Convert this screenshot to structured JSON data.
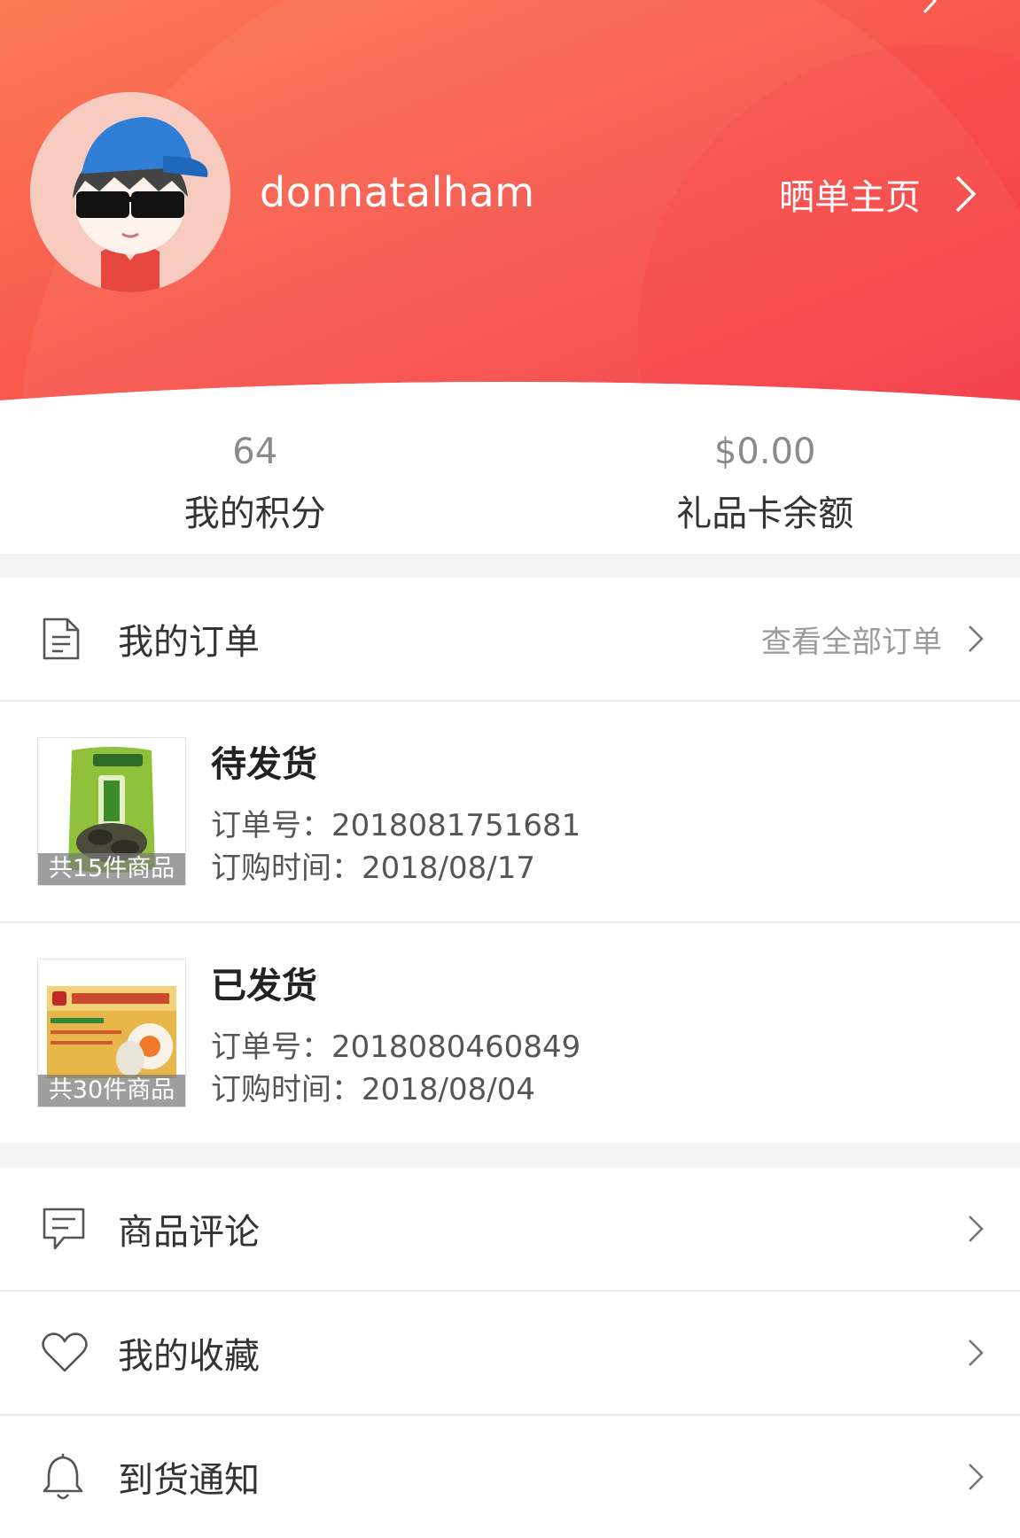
{
  "profile": {
    "username": "donnatalham",
    "homepage_label": "晒单主页"
  },
  "stats": [
    {
      "value": "64",
      "label": "我的积分"
    },
    {
      "value": "$0.00",
      "label": "礼品卡余额"
    }
  ],
  "orders_section": {
    "title": "我的订单",
    "view_all": "查看全部订单"
  },
  "orders": [
    {
      "status": "待发货",
      "order_no_line": "订单号：2018081751681",
      "date_line": "订购时间：2018/08/17",
      "count": "共15件商品"
    },
    {
      "status": "已发货",
      "order_no_line": "订单号：2018080460849",
      "date_line": "订购时间：2018/08/04",
      "count": "共30件商品"
    }
  ],
  "menu": [
    {
      "label": "商品评论",
      "icon": "comment-icon"
    },
    {
      "label": "我的收藏",
      "icon": "heart-icon"
    },
    {
      "label": "到货通知",
      "icon": "bell-icon"
    }
  ],
  "colors": {
    "header_gradient_start": "#fb6c50",
    "header_gradient_end": "#f4404a",
    "background": "#f4f4f4"
  }
}
